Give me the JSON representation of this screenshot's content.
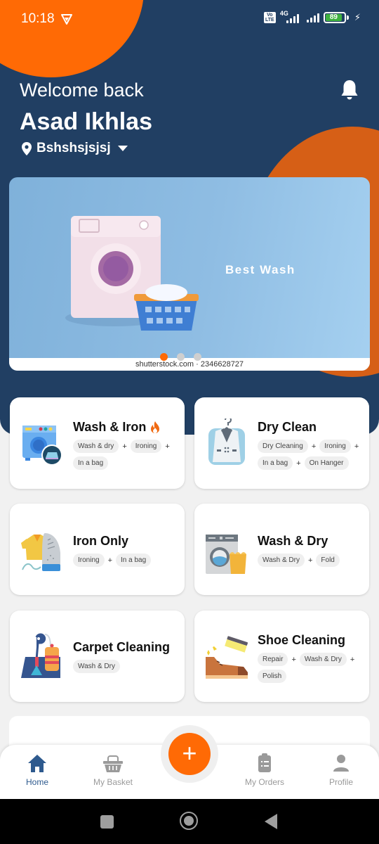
{
  "status_bar": {
    "time": "10:18",
    "network_label": "4G",
    "volte_label": "Vo LTE",
    "battery_percent": "89",
    "charging": true
  },
  "header": {
    "welcome": "Welcome back",
    "user_name": "Asad Ikhlas",
    "location": "Bshshsjsjsj"
  },
  "banner": {
    "title": "Best Wash",
    "watermark": "shutterstock.com · 2346628727",
    "slide_count": 3,
    "active_slide": 1
  },
  "services": [
    {
      "title": "Wash & Iron",
      "hot": true,
      "tags": [
        "Wash & dry",
        "Ironing",
        "In a bag"
      ]
    },
    {
      "title": "Dry Clean",
      "hot": false,
      "tags": [
        "Dry Cleaning",
        "Ironing",
        "In a bag",
        "On Hanger"
      ]
    },
    {
      "title": "Iron Only",
      "hot": false,
      "tags": [
        "Ironing",
        "In a bag"
      ]
    },
    {
      "title": "Wash & Dry",
      "hot": false,
      "tags": [
        "Wash & Dry",
        "Fold"
      ]
    },
    {
      "title": "Carpet Cleaning",
      "hot": false,
      "tags": [
        "Wash & Dry"
      ]
    },
    {
      "title": "Shoe Cleaning",
      "hot": false,
      "tags": [
        "Repair",
        "Wash & Dry",
        "Polish"
      ]
    }
  ],
  "tag_separator": "+",
  "bottom_nav": {
    "items": [
      {
        "label": "Home",
        "icon": "home-icon",
        "active": true
      },
      {
        "label": "My Basket",
        "icon": "basket-icon",
        "active": false
      },
      {
        "label": "My Orders",
        "icon": "clipboard-icon",
        "active": false
      },
      {
        "label": "Profile",
        "icon": "person-icon",
        "active": false
      }
    ],
    "fab_label": "+"
  },
  "colors": {
    "primary_navy": "#213f63",
    "accent_orange": "#ff6a05",
    "nav_active": "#2e5a8e",
    "nav_inactive": "#9a9a9a"
  }
}
